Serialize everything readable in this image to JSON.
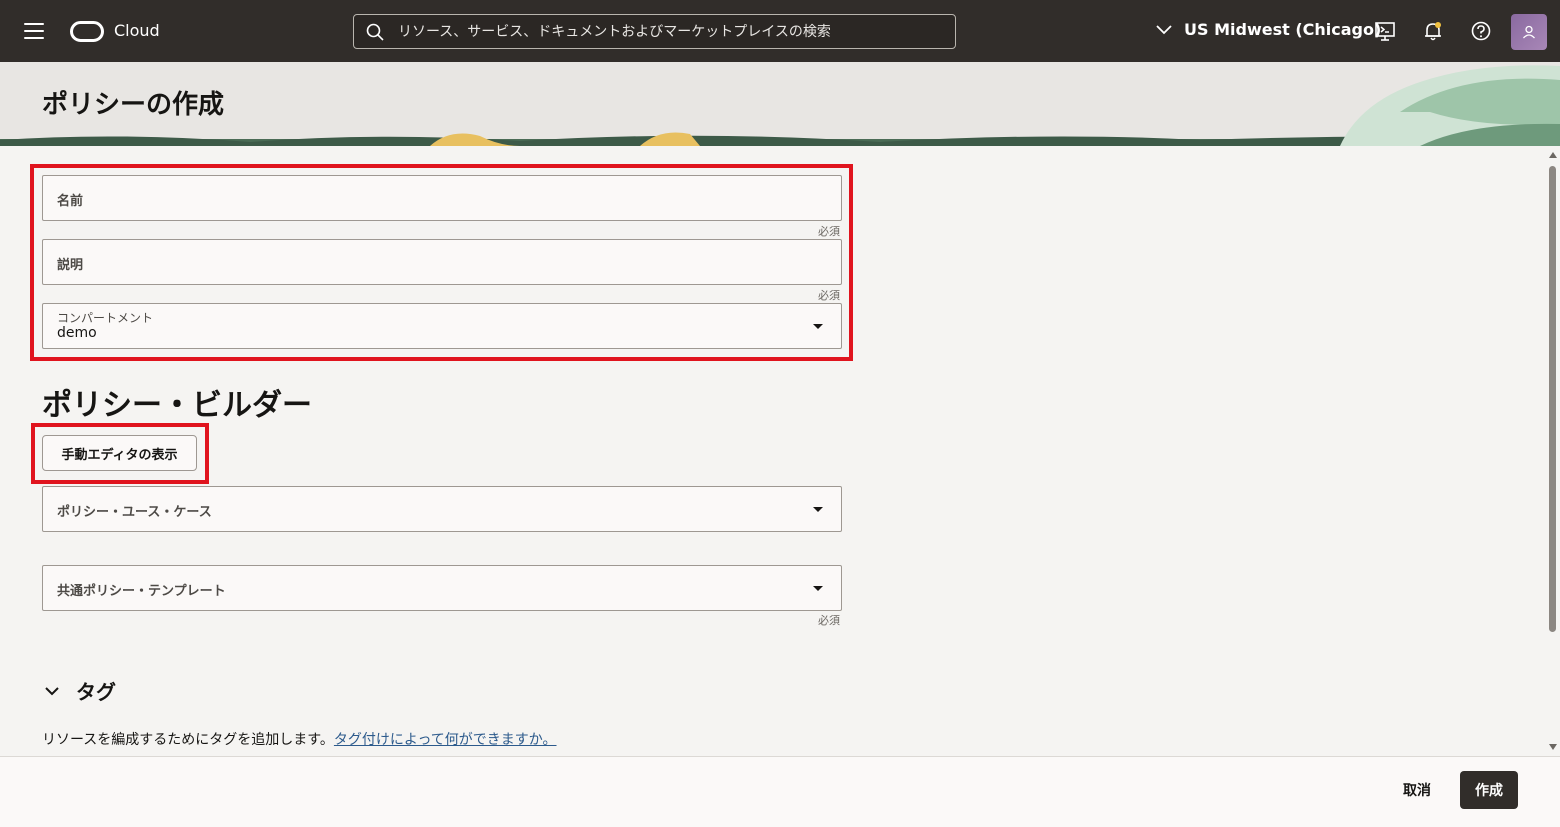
{
  "topbar": {
    "brand": "Cloud",
    "search_placeholder": "リソース、サービス、ドキュメントおよびマーケットプレイスの検索",
    "region": "US Midwest (Chicago)"
  },
  "page": {
    "title": "ポリシーの作成"
  },
  "form": {
    "name_label": "名前",
    "name_required": "必須",
    "description_label": "説明",
    "description_required": "必須",
    "compartment_label": "コンパートメント",
    "compartment_value": "demo"
  },
  "builder": {
    "title": "ポリシー・ビルダー",
    "manual_editor_button": "手動エディタの表示",
    "use_case_placeholder": "ポリシー・ユース・ケース",
    "template_placeholder": "共通ポリシー・テンプレート",
    "template_required": "必須"
  },
  "tags": {
    "title": "タグ",
    "description": "リソースを編成するためにタグを追加します。",
    "link": "タグ付けによって何ができますか。"
  },
  "footer": {
    "cancel": "取消",
    "create": "作成"
  },
  "colors": {
    "topbar": "#312d2a",
    "highlight": "#e0141e",
    "link": "#2c5a8c"
  }
}
